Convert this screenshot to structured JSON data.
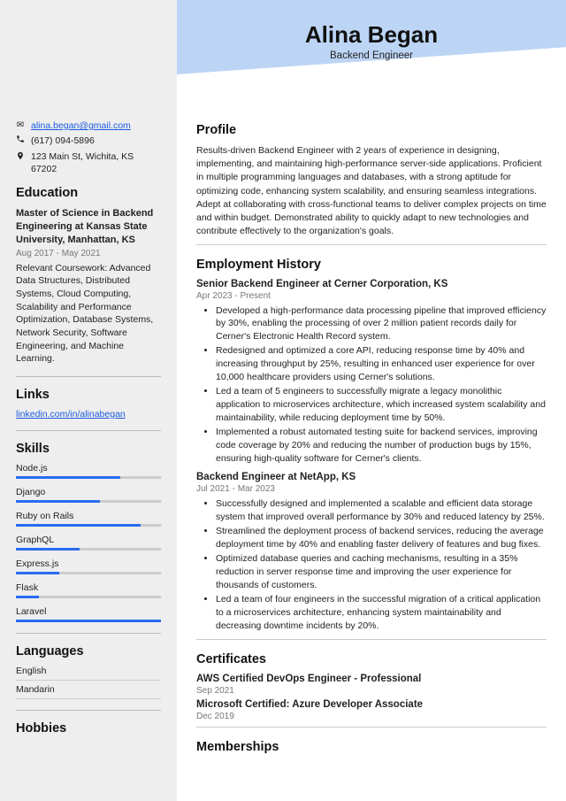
{
  "header": {
    "name": "Alina Began",
    "title": "Backend Engineer"
  },
  "contact": {
    "email": "alina.began@gmail.com",
    "phone": "(617) 094-5896",
    "address": "123 Main St, Wichita, KS 67202"
  },
  "sections": {
    "education": "Education",
    "links": "Links",
    "skills": "Skills",
    "languages": "Languages",
    "hobbies": "Hobbies",
    "profile": "Profile",
    "employment": "Employment History",
    "certificates": "Certificates",
    "memberships": "Memberships"
  },
  "education": {
    "title": "Master of Science in Backend Engineering at Kansas State University, Manhattan, KS",
    "dates": "Aug 2017 - May 2021",
    "desc": "Relevant Coursework: Advanced Data Structures, Distributed Systems, Cloud Computing, Scalability and Performance Optimization, Database Systems, Network Security, Software Engineering, and Machine Learning."
  },
  "links": {
    "linkedin": "linkedin.com/in/alinabegan"
  },
  "skills": [
    {
      "name": "Node.js",
      "pct": 72
    },
    {
      "name": "Django",
      "pct": 58
    },
    {
      "name": "Ruby on Rails",
      "pct": 86
    },
    {
      "name": "GraphQL",
      "pct": 44
    },
    {
      "name": "Express.js",
      "pct": 30
    },
    {
      "name": "Flask",
      "pct": 16
    },
    {
      "name": "Laravel",
      "pct": 100
    }
  ],
  "languages": [
    {
      "name": "English"
    },
    {
      "name": "Mandarin"
    }
  ],
  "profile": "Results-driven Backend Engineer with 2 years of experience in designing, implementing, and maintaining high-performance server-side applications. Proficient in multiple programming languages and databases, with a strong aptitude for optimizing code, enhancing system scalability, and ensuring seamless integrations. Adept at collaborating with cross-functional teams to deliver complex projects on time and within budget. Demonstrated ability to quickly adapt to new technologies and contribute effectively to the organization's goals.",
  "employment": [
    {
      "title": "Senior Backend Engineer at Cerner Corporation, KS",
      "dates": "Apr 2023 - Present",
      "bullets": [
        "Developed a high-performance data processing pipeline that improved efficiency by 30%, enabling the processing of over 2 million patient records daily for Cerner's Electronic Health Record system.",
        "Redesigned and optimized a core API, reducing response time by 40% and increasing throughput by 25%, resulting in enhanced user experience for over 10,000 healthcare providers using Cerner's solutions.",
        "Led a team of 5 engineers to successfully migrate a legacy monolithic application to microservices architecture, which increased system scalability and maintainability, while reducing deployment time by 50%.",
        "Implemented a robust automated testing suite for backend services, improving code coverage by 20% and reducing the number of production bugs by 15%, ensuring high-quality software for Cerner's clients."
      ]
    },
    {
      "title": "Backend Engineer at NetApp, KS",
      "dates": "Jul 2021 - Mar 2023",
      "bullets": [
        "Successfully designed and implemented a scalable and efficient data storage system that improved overall performance by 30% and reduced latency by 25%.",
        "Streamlined the deployment process of backend services, reducing the average deployment time by 40% and enabling faster delivery of features and bug fixes.",
        "Optimized database queries and caching mechanisms, resulting in a 35% reduction in server response time and improving the user experience for thousands of customers.",
        "Led a team of four engineers in the successful migration of a critical application to a microservices architecture, enhancing system maintainability and decreasing downtime incidents by 20%."
      ]
    }
  ],
  "certificates": [
    {
      "title": "AWS Certified DevOps Engineer - Professional",
      "dates": "Sep 2021"
    },
    {
      "title": "Microsoft Certified: Azure Developer Associate",
      "dates": "Dec 2019"
    }
  ]
}
